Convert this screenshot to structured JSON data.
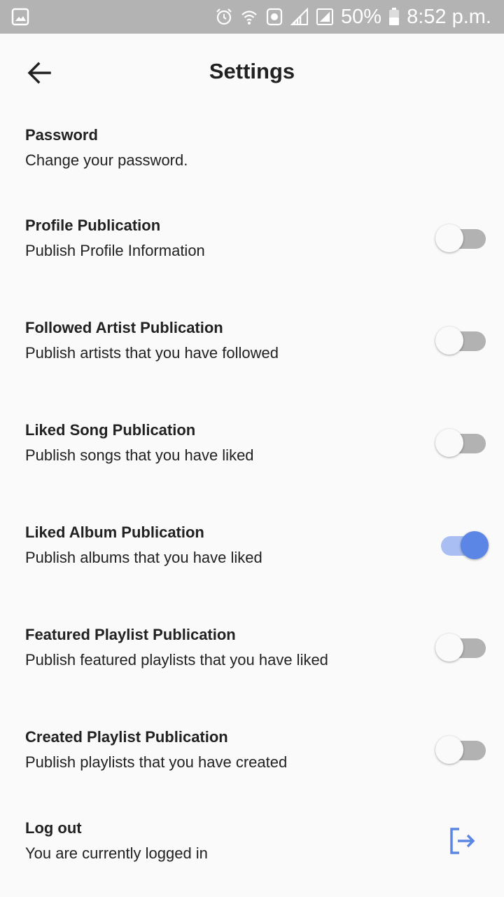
{
  "status_bar": {
    "battery": "50%",
    "time": "8:52 p.m."
  },
  "header": {
    "title": "Settings"
  },
  "settings": [
    {
      "title": "Password",
      "subtitle": "Change your password."
    },
    {
      "title": "Profile Publication",
      "subtitle": "Publish Profile Information",
      "enabled": false
    },
    {
      "title": "Followed Artist Publication",
      "subtitle": "Publish artists that you have followed",
      "enabled": false
    },
    {
      "title": "Liked Song Publication",
      "subtitle": "Publish songs that you have liked",
      "enabled": false
    },
    {
      "title": "Liked Album Publication",
      "subtitle": "Publish albums that you have liked",
      "enabled": true
    },
    {
      "title": "Featured Playlist Publication",
      "subtitle": "Publish featured playlists that you have liked",
      "enabled": false
    },
    {
      "title": "Created Playlist Publication",
      "subtitle": "Publish playlists that you have created",
      "enabled": false
    },
    {
      "title": "Log out",
      "subtitle": "You are currently logged in"
    }
  ],
  "colors": {
    "accent": "#5b86e5",
    "accent_track": "#a9bff3",
    "off_track": "#b2b2b2"
  }
}
